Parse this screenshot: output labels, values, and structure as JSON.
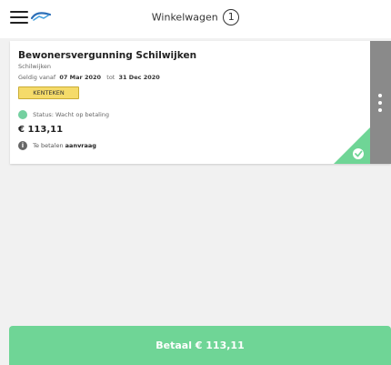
{
  "header": {
    "cart_label": "Winkelwagen",
    "cart_count": "1"
  },
  "card": {
    "title": "Bewonersvergunning Schilwijken",
    "subtitle": "Schilwijken",
    "valid_prefix": "Geldig vanaf",
    "valid_from": "07 Mar 2020",
    "valid_mid": "tot",
    "valid_to": "31 Dec 2020",
    "plate_label": "KENTEKEN",
    "status": "Status: Wacht op betaling",
    "price": "€ 113,11",
    "pay_prefix": "Te betalen",
    "pay_link": "aanvraag"
  },
  "footer": {
    "pay_button": "Betaal € 113,11"
  },
  "colors": {
    "accent_green": "#6fd596",
    "plate_yellow": "#f5db6a",
    "side_grey": "#8a8a8a"
  },
  "icons": {
    "menu": "hamburger-icon",
    "logo": "car-logo-icon",
    "options": "kebab-menu-icon",
    "status": "status-dot-icon",
    "info": "info-icon",
    "check": "checkmark-icon"
  }
}
